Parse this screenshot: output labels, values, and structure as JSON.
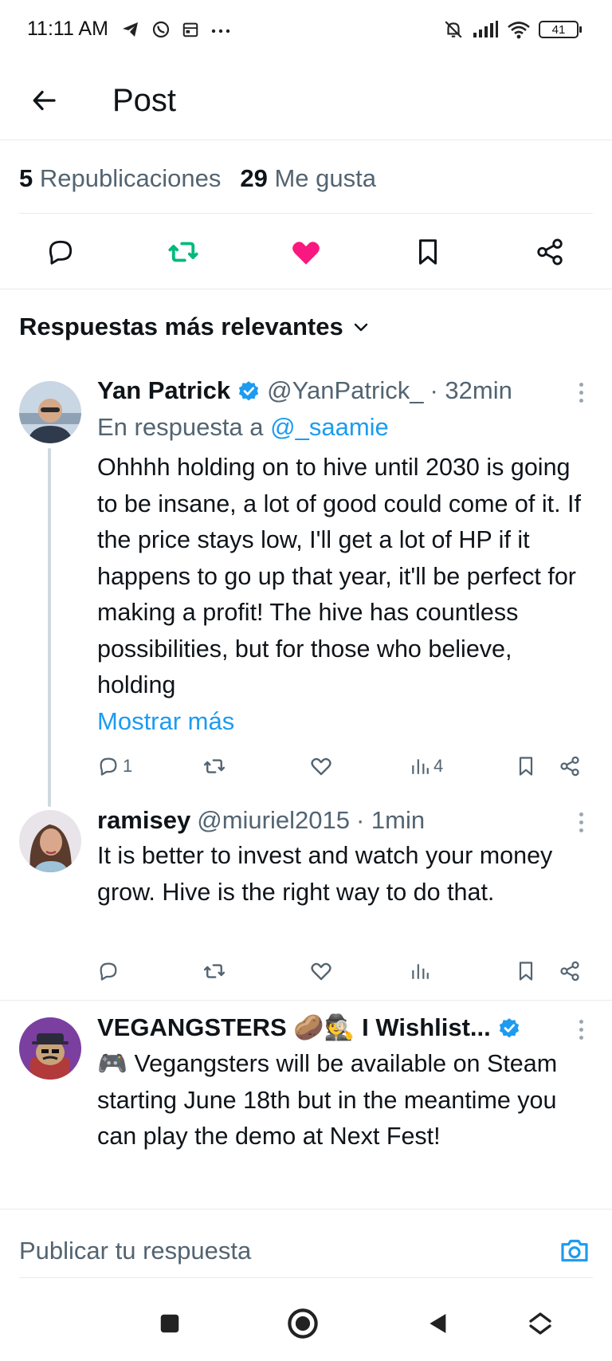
{
  "status_bar": {
    "time": "11:11 AM",
    "battery": "41"
  },
  "header": {
    "title": "Post"
  },
  "stats": {
    "reposts_count": "5",
    "reposts_label": "Republicaciones",
    "likes_count": "29",
    "likes_label": "Me gusta"
  },
  "colors": {
    "retweet_green": "#00ba7c",
    "like_pink": "#f91880",
    "link_blue": "#1d9bf0",
    "verified_blue": "#1d9bf0"
  },
  "section": {
    "title": "Respuestas más relevantes"
  },
  "replies": [
    {
      "author": "Yan Patrick",
      "handle": "@YanPatrick_",
      "time": "· 32min",
      "reply_to_label": "En respuesta a",
      "reply_to_handle": "@_saamie",
      "body": "Ohhhh holding on to hive until 2030 is going to be insane, a lot of good could come of it. If the price stays low, I'll get a lot of HP if it happens to go up that year, it'll be perfect for making a profit! The hive has countless possibilities, but for those who believe, holding",
      "show_more": "Mostrar más",
      "reply_count": "1",
      "views_count": "4"
    },
    {
      "author": "ramisey",
      "handle": "@miuriel2015",
      "time": "· 1min",
      "body": "It is better to invest and watch your money grow. Hive is the right way to do that."
    },
    {
      "author": "VEGANGSTERS 🥔🕵 I Wishlist...",
      "body": "🎮 Vegangsters will be available on Steam starting June 18th but in the meantime you can play the demo at Next Fest!"
    }
  ],
  "composer": {
    "placeholder": "Publicar tu respuesta"
  }
}
